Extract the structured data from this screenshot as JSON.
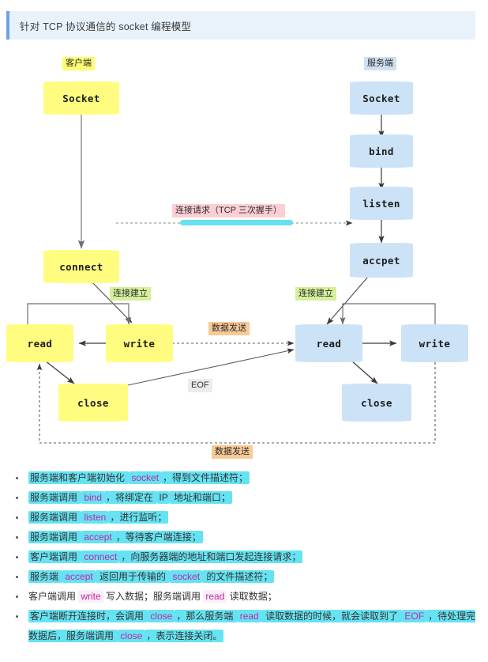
{
  "header": {
    "title": "针对 TCP 协议通信的 socket 编程模型",
    "accent": "#6aa3e0",
    "bg": "#e8f2fb"
  },
  "diagram": {
    "client_label": "客户端",
    "server_label": "服务端",
    "client_color": "#fffc7f",
    "server_color": "#cce3f7",
    "client_nodes": {
      "socket": "Socket",
      "connect": "connect",
      "read": "read",
      "write": "write",
      "close": "close"
    },
    "server_nodes": {
      "socket": "Socket",
      "bind": "bind",
      "listen": "listen",
      "accept": "accpet",
      "read": "read",
      "write": "write",
      "close": "close"
    },
    "edge_labels": {
      "handshake": "连接请求（TCP 三次握手）",
      "established_client": "连接建立",
      "established_server": "连接建立",
      "data_send_top": "数据发送",
      "data_send_bottom": "数据发送",
      "eof": "EOF"
    }
  },
  "notes": [
    {
      "id": 1,
      "parts": [
        {
          "t": "服务端和客户端初始化 ",
          "s": "hl"
        },
        {
          "t": "socket",
          "s": "code-hl"
        },
        {
          "t": "，得到文件描述符；",
          "s": "hl"
        }
      ]
    },
    {
      "id": 2,
      "parts": [
        {
          "t": "服务端调用 ",
          "s": "hl"
        },
        {
          "t": "bind",
          "s": "code-hl"
        },
        {
          "t": "，将绑定在 ",
          "s": "hl"
        },
        {
          "t": "IP",
          "s": "hl"
        },
        {
          "t": " 地址和端口；",
          "s": "hl"
        }
      ]
    },
    {
      "id": 3,
      "parts": [
        {
          "t": "服务端调用 ",
          "s": "hl"
        },
        {
          "t": "listen",
          "s": "code-hl"
        },
        {
          "t": "，进行监听；",
          "s": "hl"
        }
      ]
    },
    {
      "id": 4,
      "parts": [
        {
          "t": "服务端调用 ",
          "s": "hl"
        },
        {
          "t": "accept",
          "s": "code-hl"
        },
        {
          "t": "，等待客户端连接；",
          "s": "hl"
        }
      ]
    },
    {
      "id": 5,
      "parts": [
        {
          "t": "客户端调用 ",
          "s": "hl"
        },
        {
          "t": "connect",
          "s": "code-hl"
        },
        {
          "t": "，向服务器端的地址和端口发起连接请求；",
          "s": "hl"
        }
      ]
    },
    {
      "id": 6,
      "parts": [
        {
          "t": "服务端 ",
          "s": "hl"
        },
        {
          "t": "accept",
          "s": "code-hl"
        },
        {
          "t": " 返回用于传输的 ",
          "s": "hl"
        },
        {
          "t": "socket",
          "s": "code-hl"
        },
        {
          "t": " 的文件描述符；",
          "s": "hl"
        }
      ]
    },
    {
      "id": 7,
      "parts": [
        {
          "t": "客户端调用 ",
          "s": "plain"
        },
        {
          "t": "write",
          "s": "code-plain"
        },
        {
          "t": " 写入数据；服务端调用 ",
          "s": "plain"
        },
        {
          "t": "read",
          "s": "code-plain"
        },
        {
          "t": " 读取数据；",
          "s": "plain"
        }
      ]
    },
    {
      "id": 8,
      "parts": [
        {
          "t": "客户端断开连接时，会调用 ",
          "s": "hl"
        },
        {
          "t": "close",
          "s": "code-hl"
        },
        {
          "t": "，那么服务端 ",
          "s": "hl"
        },
        {
          "t": "read",
          "s": "code-hl"
        },
        {
          "t": " 读取数据的时候，就会读取到了 ",
          "s": "hl"
        },
        {
          "t": "EOF",
          "s": "code-hl"
        },
        {
          "t": "，待处理完数据后，服务端调用 ",
          "s": "hl"
        },
        {
          "t": "close",
          "s": "code-hl"
        },
        {
          "t": "，表示连接关闭。",
          "s": "hl"
        }
      ]
    }
  ],
  "colors": {
    "highlight_cyan": "#66e3f2",
    "code_purple": "#c026a8",
    "tag_yellow": "#fdfc74",
    "tag_blue": "#cfe0f2",
    "tag_green": "#d5ef9a",
    "tag_pink": "#fccfd4",
    "tag_orange": "#f8ca96",
    "tag_grey": "#ececec"
  }
}
